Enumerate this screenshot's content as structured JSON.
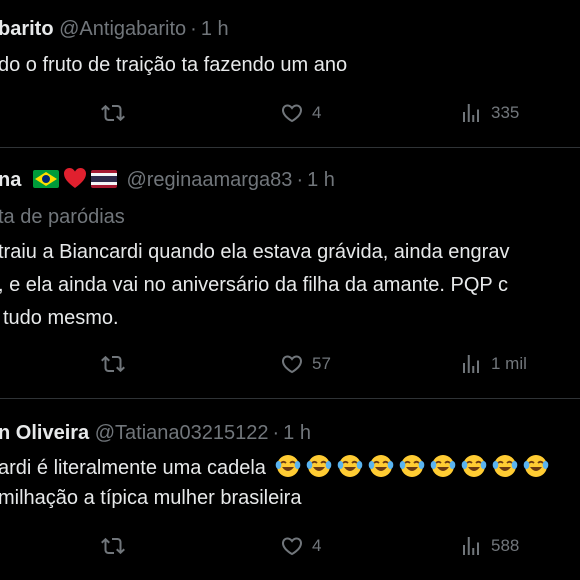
{
  "tweets": [
    {
      "name": "barito",
      "handle": "@Antigabarito",
      "separator": "·",
      "time": "1 h",
      "lines": [
        "do o fruto de traição ta fazendo um ano"
      ],
      "retweet_count": "",
      "like_count": "4",
      "view_count": "335"
    },
    {
      "name": "na",
      "handle": "@reginaamarga83",
      "separator": "·",
      "time": "1 h",
      "sublabel": "ta de paródias",
      "lines": [
        "traiu a Biancardi quando ela estava grávida, ainda engrav",
        ", e ela ainda vai no aniversário da filha da amante. PQP c",
        "tudo mesmo."
      ],
      "retweet_count": "",
      "like_count": "57",
      "view_count": "1 mil"
    },
    {
      "name": "n Oliveira",
      "handle": "@Tatiana03215122",
      "separator": "·",
      "time": "1 h",
      "lines": [
        "ardi é literalmente uma cadela",
        "milhação a típica mulher brasileira"
      ],
      "retweet_count": "",
      "like_count": "4",
      "view_count": "588"
    }
  ],
  "icons": {
    "retweet": "retweet-icon",
    "like": "heart-outline-icon",
    "views": "views-bar-chart-icon",
    "flag_brazil": "brazil-flag-emoji",
    "heart_emoji": "red-heart-emoji",
    "flag_thailand": "thailand-flag-emoji",
    "laugh_emoji": "tears-of-joy-emoji"
  },
  "colors": {
    "background": "#000000",
    "text_primary": "#e7e9ea",
    "text_secondary": "#71767b",
    "divider": "#2f3336"
  }
}
